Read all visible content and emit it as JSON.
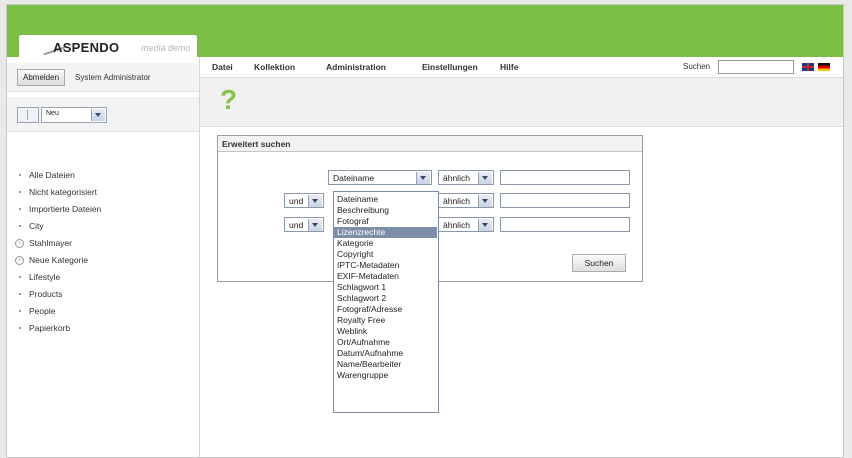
{
  "brand": {
    "name": "ASPENDO",
    "subtitle": "media demo"
  },
  "user": {
    "logout_label": "Abmelden",
    "name": "System Administrator"
  },
  "view": {
    "selected": "Neu"
  },
  "sidebar": {
    "items": [
      {
        "label": "Alle Dateien",
        "marker": "dot"
      },
      {
        "label": "Nicht kategorisiert",
        "marker": "dot"
      },
      {
        "label": "Importierte Dateien",
        "marker": "dot"
      },
      {
        "label": "City",
        "marker": "dot"
      },
      {
        "label": "Stahlmayer",
        "marker": "expand"
      },
      {
        "label": "Neue Kategorie",
        "marker": "expand"
      },
      {
        "label": "Lifestyle",
        "marker": "dot"
      },
      {
        "label": "Products",
        "marker": "dot"
      },
      {
        "label": "People",
        "marker": "dot"
      },
      {
        "label": "Papierkorb",
        "marker": "dot"
      }
    ]
  },
  "menu": {
    "items": [
      "Datei",
      "Kollektion",
      "Administration",
      "Einstellungen",
      "Hilfe"
    ],
    "search_label": "Suchen",
    "search_value": ""
  },
  "help_icon": "?",
  "search_panel": {
    "title": "Erweitert suchen",
    "rows": [
      {
        "connector": "",
        "field": "Dateiname",
        "operator": "ähnlich",
        "value": ""
      },
      {
        "connector": "und",
        "field": "",
        "operator": "ähnlich",
        "value": ""
      },
      {
        "connector": "und",
        "field": "",
        "operator": "ähnlich",
        "value": ""
      }
    ],
    "submit_label": "Suchen"
  },
  "field_dropdown": {
    "options": [
      "Dateiname",
      "Beschreibung",
      "Fotograf",
      "Lizenzrechte",
      "Kategorie",
      "Copyright",
      "IPTC-Metadaten",
      "EXIF-Metadaten",
      "Schlagwort 1",
      "Schlagwort 2",
      "Fotograf/Adresse",
      "Royalty Free",
      "Weblink",
      "Ort/Aufnahme",
      "Datum/Aufnahme",
      "Name/Bearbeiter",
      "Warengruppe"
    ],
    "highlighted": "Lizenzrechte"
  },
  "colors": {
    "brand_green": "#7dbf44",
    "highlight": "#7e8ea8"
  }
}
